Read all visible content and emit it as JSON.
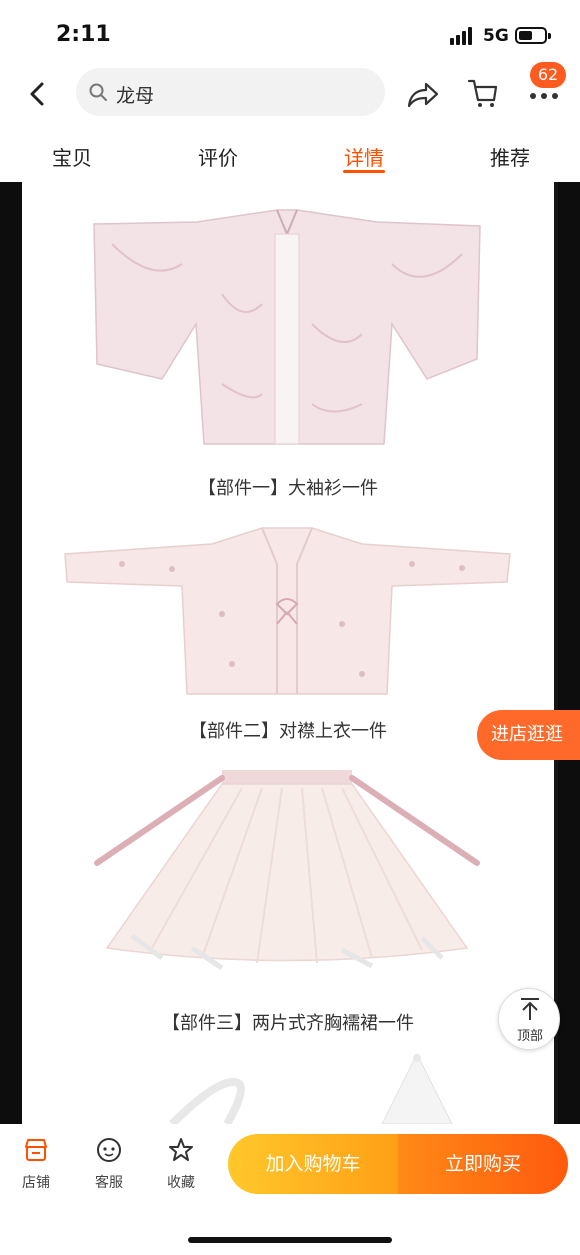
{
  "status": {
    "time": "2:11",
    "network": "5G"
  },
  "nav": {
    "search_query": "龙母",
    "cart_badge": "62"
  },
  "tabs": [
    {
      "label": "宝贝"
    },
    {
      "label": "评价"
    },
    {
      "label": "详情",
      "active": true
    },
    {
      "label": "推荐"
    }
  ],
  "pieces": [
    {
      "caption": "【部件一】大袖衫一件"
    },
    {
      "caption": "【部件二】对襟上衣一件"
    },
    {
      "caption": "【部件三】两片式齐胸襦裙一件"
    }
  ],
  "floating": {
    "shop_button": "进店逛逛",
    "back_to_top": "顶部"
  },
  "bottom_bar": {
    "shop": "店铺",
    "service": "客服",
    "favorite": "收藏",
    "add_to_cart": "加入购物车",
    "buy_now": "立即购买"
  },
  "colors": {
    "accent": "#ff5000",
    "cart_button": "#ffb020",
    "buy_button": "#ff6a10"
  }
}
